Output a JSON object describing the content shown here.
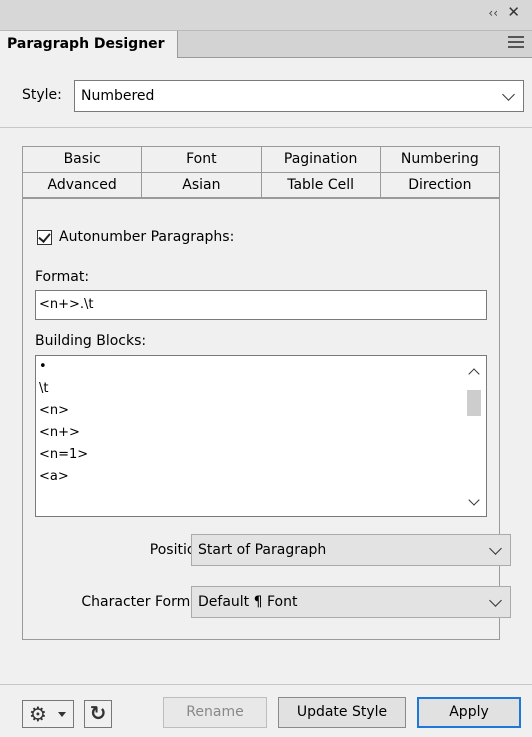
{
  "panel": {
    "tab_title": "Paragraph Designer"
  },
  "style": {
    "label": "Style:",
    "value": "Numbered"
  },
  "tabs": {
    "row1": [
      "Basic",
      "Font",
      "Pagination",
      "Numbering"
    ],
    "row2": [
      "Advanced",
      "Asian",
      "Table Cell",
      "Direction"
    ],
    "active": "Numbering"
  },
  "numbering": {
    "autonumber_label": "Autonumber Paragraphs:",
    "autonumber_checked": true,
    "format_label": "Format:",
    "format_value": "<n+>.\\t",
    "building_blocks_label": "Building Blocks:",
    "building_blocks": [
      "•",
      "\\t",
      "<n>",
      "<n+>",
      "<n=1>",
      "<a>"
    ],
    "position_label": "Position:",
    "position_value": "Start of Paragraph",
    "char_format_label": "Character Format:",
    "char_format_value": "Default ¶ Font"
  },
  "footer": {
    "rename_label": "Rename",
    "update_label": "Update Style",
    "apply_label": "Apply"
  },
  "icons": {
    "collapse": "double-chevron-left-icon",
    "close": "close-icon",
    "menu": "hamburger-menu-icon",
    "gear": "gear-icon",
    "refresh": "refresh-icon"
  },
  "colors": {
    "apply_border": "#1e78d7"
  }
}
